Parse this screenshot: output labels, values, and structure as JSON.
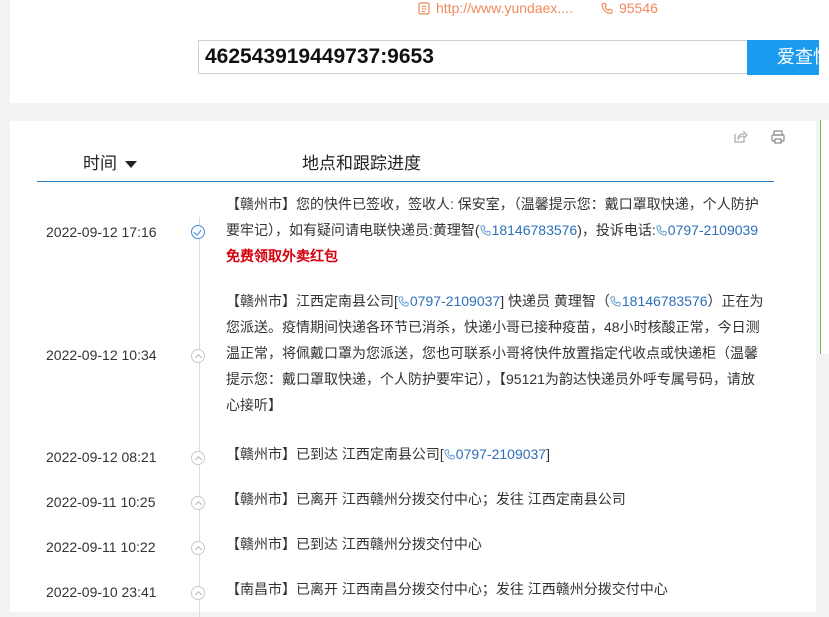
{
  "header": {
    "website": "http://www.yundaex....",
    "hotline": "95546",
    "tracking_number": "462543919449737:9653",
    "search_button": "爱查快递"
  },
  "table": {
    "col_time": "时间",
    "col_location": "地点和跟踪进度"
  },
  "events": [
    {
      "time": "2022-09-12 17:16",
      "status": "done",
      "seg": [
        {
          "t": "【赣州市】您的快件已签收，签收人: 保安室，（温馨提示您：戴口罩取快递，个人防护要牢记），如有疑问请电联快递员:黄理智("
        },
        {
          "t": "18146783576",
          "cls": "blue",
          "ph": true
        },
        {
          "t": ")，投诉电话:"
        },
        {
          "t": "0797-2109039",
          "cls": "blue",
          "ph": true
        },
        {
          "t": "免费领取外卖红包",
          "cls": "red"
        }
      ]
    },
    {
      "time": "2022-09-12 10:34",
      "status": "up",
      "seg": [
        {
          "t": "【赣州市】江西定南县公司["
        },
        {
          "t": "0797-2109037",
          "cls": "blue",
          "ph": true
        },
        {
          "t": "] 快递员 黄理智（"
        },
        {
          "t": "18146783576",
          "cls": "blue",
          "ph": true
        },
        {
          "t": "）正在为您派送。疫情期间快递各环节已消杀，快递小哥已接种疫苗，48小时核酸正常，今日测温正常，将佩戴口罩为您派送，您也可联系小哥将快件放置指定代收点或快递柜（温馨提示您：戴口罩取快递，个人防护要牢记），【95121为韵达快递员外呼专属号码，请放心接听】"
        }
      ]
    },
    {
      "time": "2022-09-12 08:21",
      "status": "up",
      "seg": [
        {
          "t": "【赣州市】已到达 江西定南县公司["
        },
        {
          "t": "0797-2109037",
          "cls": "blue",
          "ph": true
        },
        {
          "t": "]"
        }
      ]
    },
    {
      "time": "2022-09-11 10:25",
      "status": "up",
      "seg": [
        {
          "t": "【赣州市】已离开 江西赣州分拨交付中心；发往 江西定南县公司"
        }
      ]
    },
    {
      "time": "2022-09-11 10:22",
      "status": "up",
      "seg": [
        {
          "t": "【赣州市】已到达 江西赣州分拨交付中心"
        }
      ]
    },
    {
      "time": "2022-09-10 23:41",
      "status": "up",
      "seg": [
        {
          "t": "【南昌市】已离开 江西南昌分拨交付中心；发往 江西赣州分拨交付中心"
        }
      ]
    }
  ]
}
